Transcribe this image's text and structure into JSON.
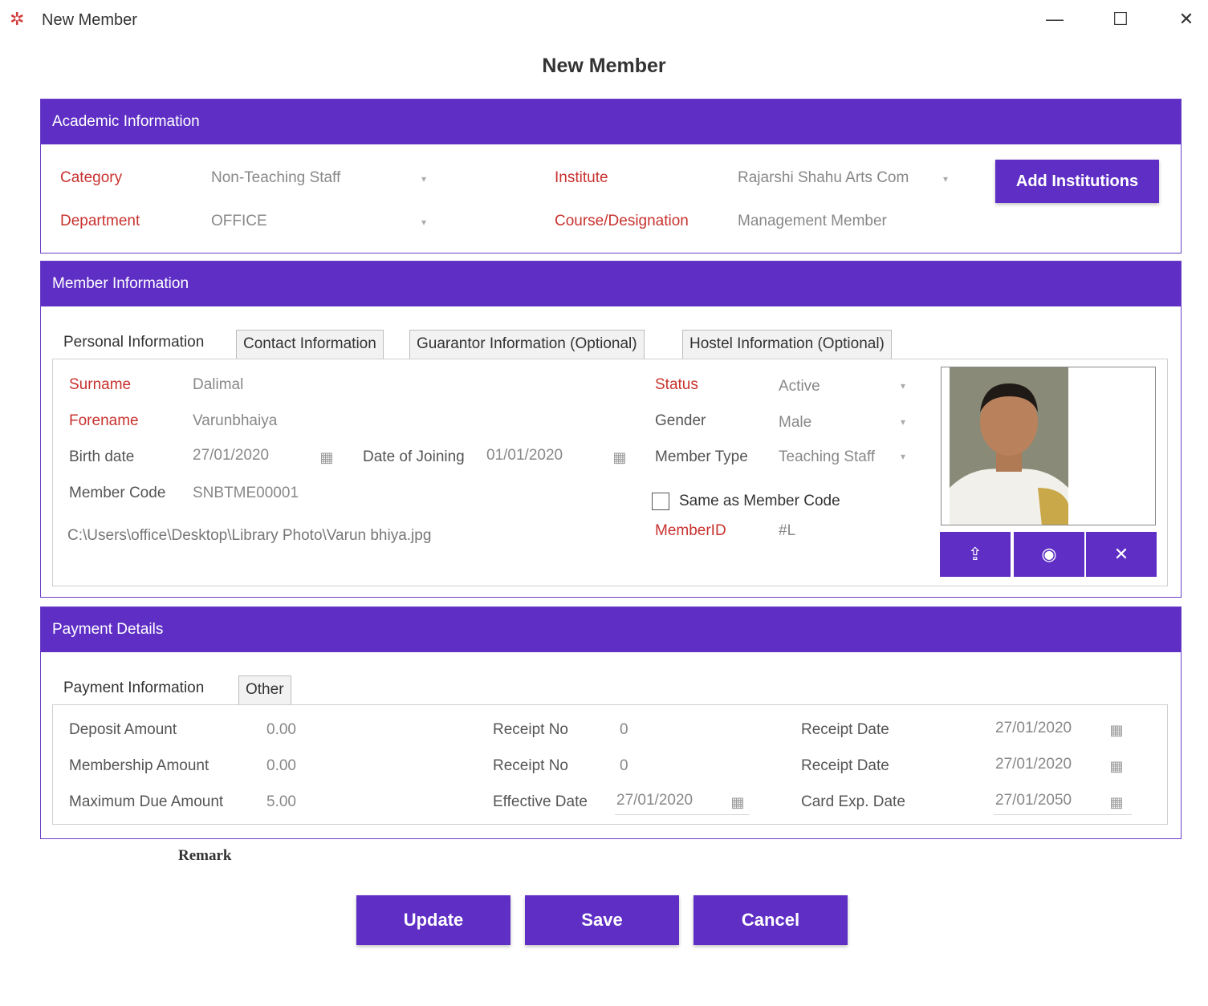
{
  "window": {
    "title": "New Member",
    "icon": "app-logo-icon",
    "minimize_glyph": "—",
    "maximize_glyph": "☐",
    "close_glyph": "✕"
  },
  "page_title": "New Member",
  "academic": {
    "header": "Academic Information",
    "category_label": "Category",
    "category_value": "Non-Teaching Staff",
    "department_label": "Department",
    "department_value": "OFFICE",
    "institute_label": "Institute",
    "institute_value": "Rajarshi Shahu Arts Com",
    "course_label": "Course/Designation",
    "course_value": "Management Member",
    "add_institutions_label": "Add Institutions"
  },
  "member": {
    "header": "Member Information",
    "tabs": [
      {
        "label": "Personal Information",
        "active": true
      },
      {
        "label": "Contact Information",
        "active": false
      },
      {
        "label": "Guarantor Information (Optional)",
        "active": false
      },
      {
        "label": "Hostel Information (Optional)",
        "active": false
      }
    ],
    "surname_label": "Surname",
    "surname_value": "Dalimal",
    "forename_label": "Forename",
    "forename_value": "Varunbhaiya",
    "birth_label": "Birth date",
    "birth_value": "27/01/2020",
    "doj_label": "Date of Joining",
    "doj_value": "01/01/2020",
    "member_code_label": "Member Code",
    "member_code_value": "SNBTME00001",
    "photo_path": "C:\\Users\\office\\Desktop\\Library Photo\\Varun bhiya.jpg",
    "status_label": "Status",
    "status_value": "Active",
    "gender_label": "Gender",
    "gender_value": "Male",
    "member_type_label": "Member Type",
    "member_type_value": "Teaching Staff",
    "same_code_label": "Same as Member Code",
    "memberid_label": "MemberID",
    "memberid_value": "#L"
  },
  "payment": {
    "header": "Payment Details",
    "tabs": [
      {
        "label": "Payment Information",
        "active": true
      },
      {
        "label": "Other",
        "active": false
      }
    ],
    "deposit_label": "Deposit Amount",
    "deposit_value": "0.00",
    "membership_label": "Membership Amount",
    "membership_value": "0.00",
    "maxdue_label": "Maximum Due Amount",
    "maxdue_value": "5.00",
    "receipt_no_label_1": "Receipt No",
    "receipt_no_value_1": "0",
    "receipt_no_label_2": "Receipt No",
    "receipt_no_value_2": "0",
    "effective_label": "Effective Date",
    "effective_value": "27/01/2020",
    "receipt_date_label_1": "Receipt Date",
    "receipt_date_value_1": "27/01/2020",
    "receipt_date_label_2": "Receipt Date",
    "receipt_date_value_2": "27/01/2020",
    "card_exp_label": "Card Exp. Date",
    "card_exp_value": "27/01/2050"
  },
  "remark_label": "Remark",
  "actions": {
    "update": "Update",
    "save": "Save",
    "cancel": "Cancel"
  },
  "colors": {
    "accent": "#5e2ec5",
    "required_label": "#c8322f"
  }
}
